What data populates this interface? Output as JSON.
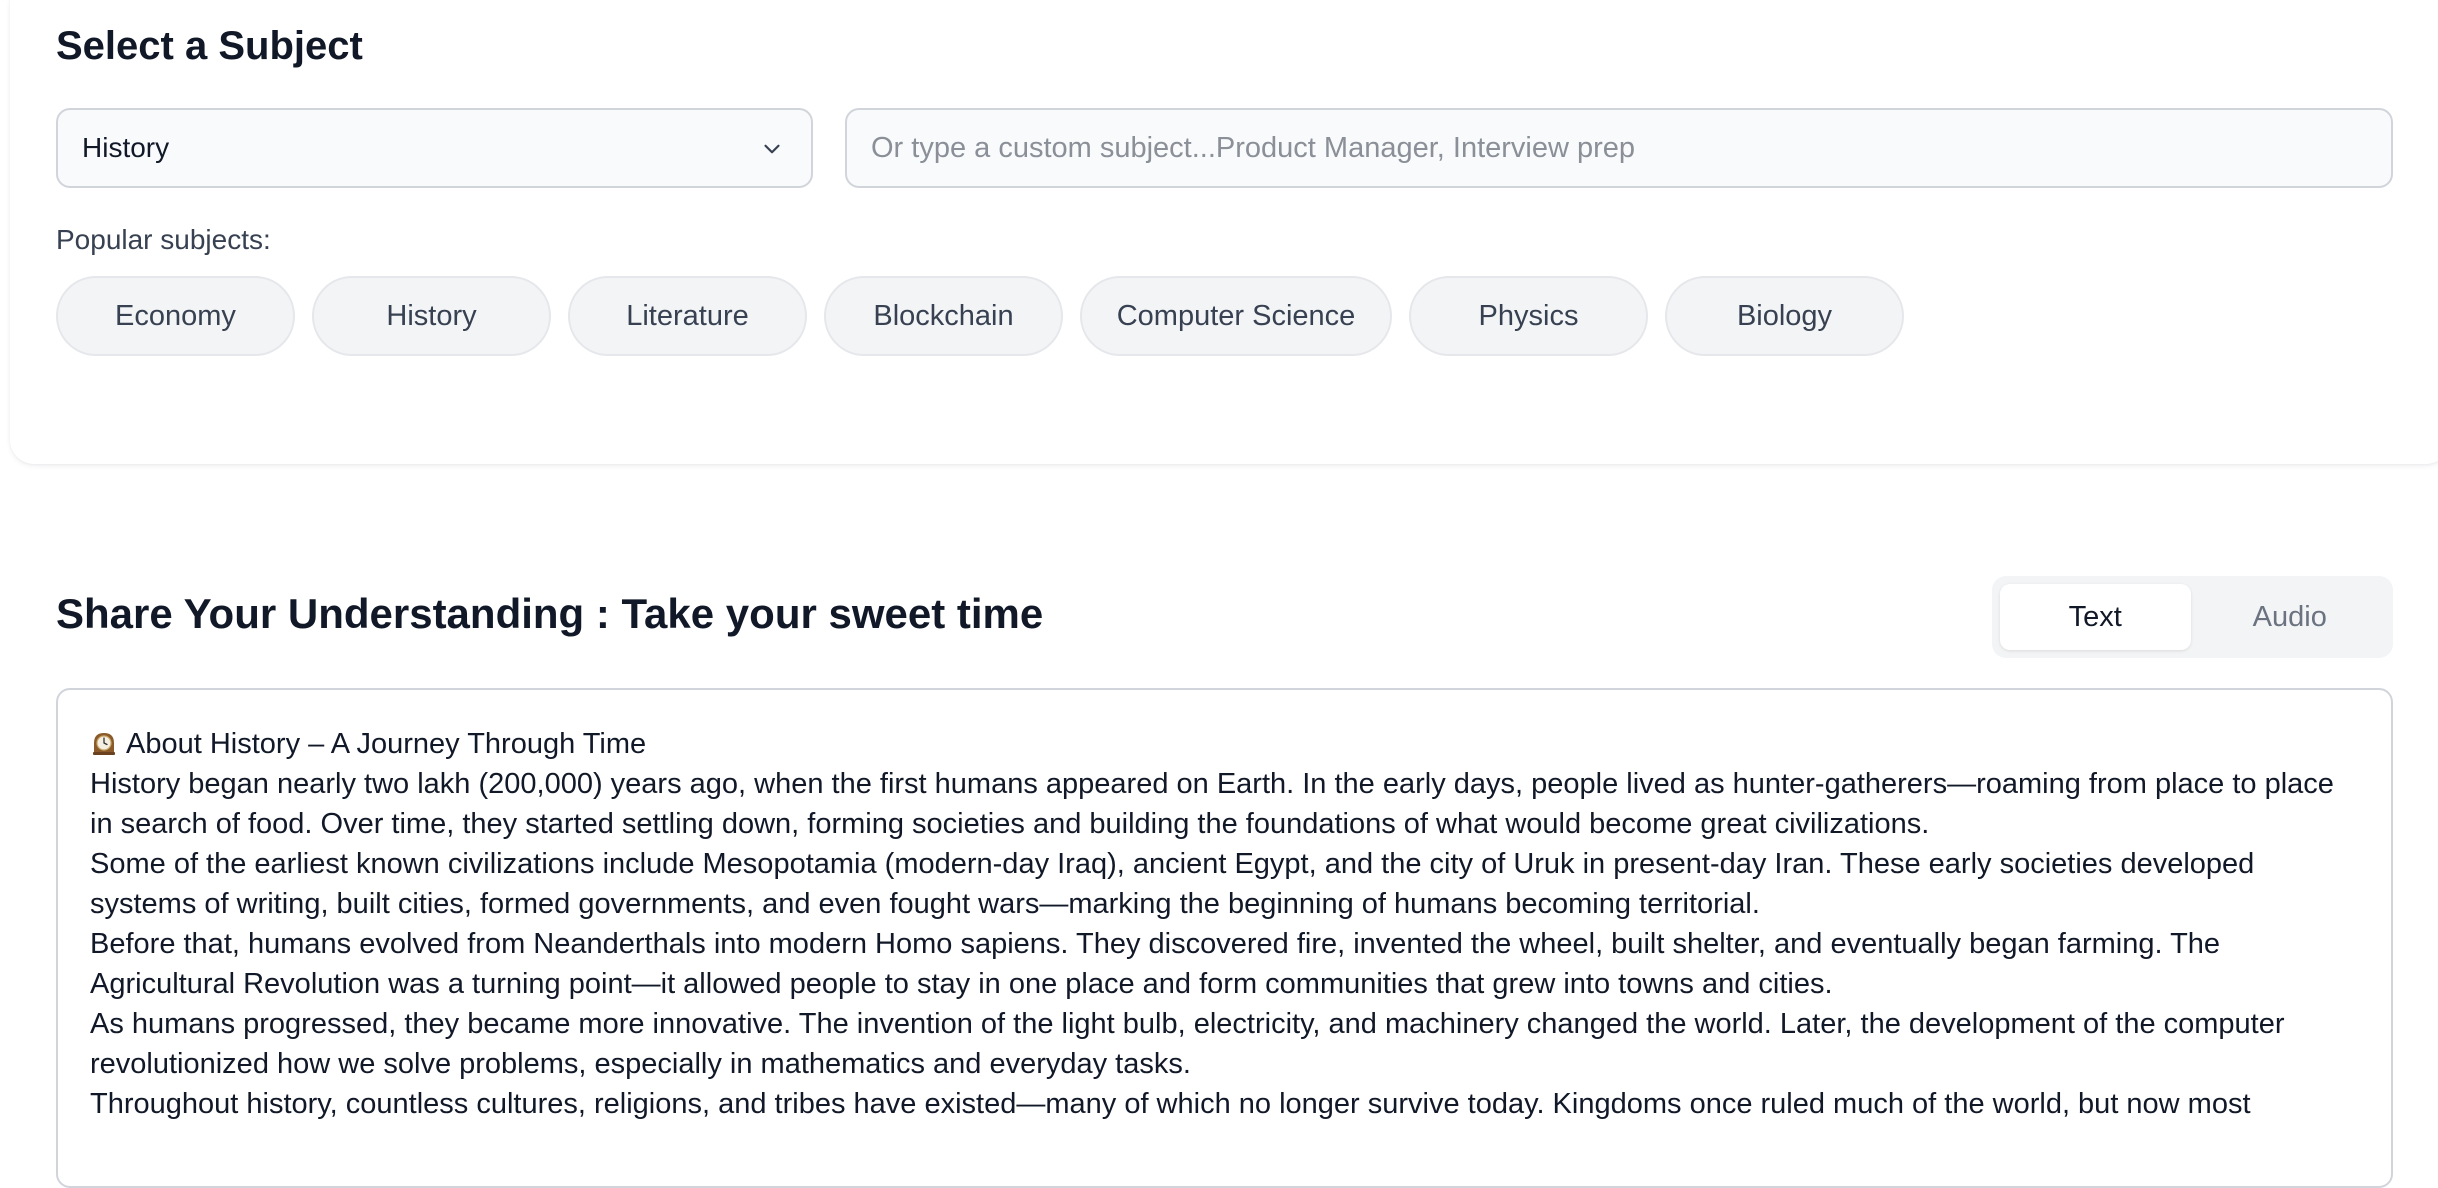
{
  "select_section": {
    "title": "Select a Subject",
    "dropdown": {
      "selected": "History",
      "icon": "chevron-down-icon"
    },
    "custom_input": {
      "value": "",
      "placeholder": "Or type a custom subject...Product Manager, Interview prep"
    },
    "popular_label": "Popular subjects:",
    "popular_subjects": [
      "Economy",
      "History",
      "Literature",
      "Blockchain",
      "Computer Science",
      "Physics",
      "Biology"
    ]
  },
  "share_section": {
    "title": "Share Your Understanding : Take your sweet time",
    "mode_toggle": {
      "options": [
        "Text",
        "Audio"
      ],
      "active": "Text"
    },
    "text_icon": "mantelpiece-clock-icon",
    "text_lines": [
      "About History – A Journey Through Time",
      "History began nearly two lakh (200,000) years ago, when the first humans appeared on Earth. In the early days, people lived as hunter-gatherers—roaming from place to place in search of food. Over time, they started settling down, forming societies and building the foundations of what would become great civilizations.",
      "Some of the earliest known civilizations include Mesopotamia (modern-day Iraq), ancient Egypt, and the city of Uruk in present-day Iran. These early societies developed systems of writing, built cities, formed governments, and even fought wars—marking the beginning of humans becoming territorial.",
      "Before that, humans evolved from Neanderthals into modern Homo sapiens. They discovered fire, invented the wheel, built shelter, and eventually began farming. The Agricultural Revolution was a turning point—it allowed people to stay in one place and form communities that grew into towns and cities.",
      "As humans progressed, they became more innovative. The invention of the light bulb, electricity, and machinery changed the world. Later, the development of the computer revolutionized how we solve problems, especially in mathematics and everyday tasks.",
      "Throughout history, countless cultures, religions, and tribes have existed—many of which no longer survive today. Kingdoms once ruled much of the world, but now most"
    ]
  }
}
